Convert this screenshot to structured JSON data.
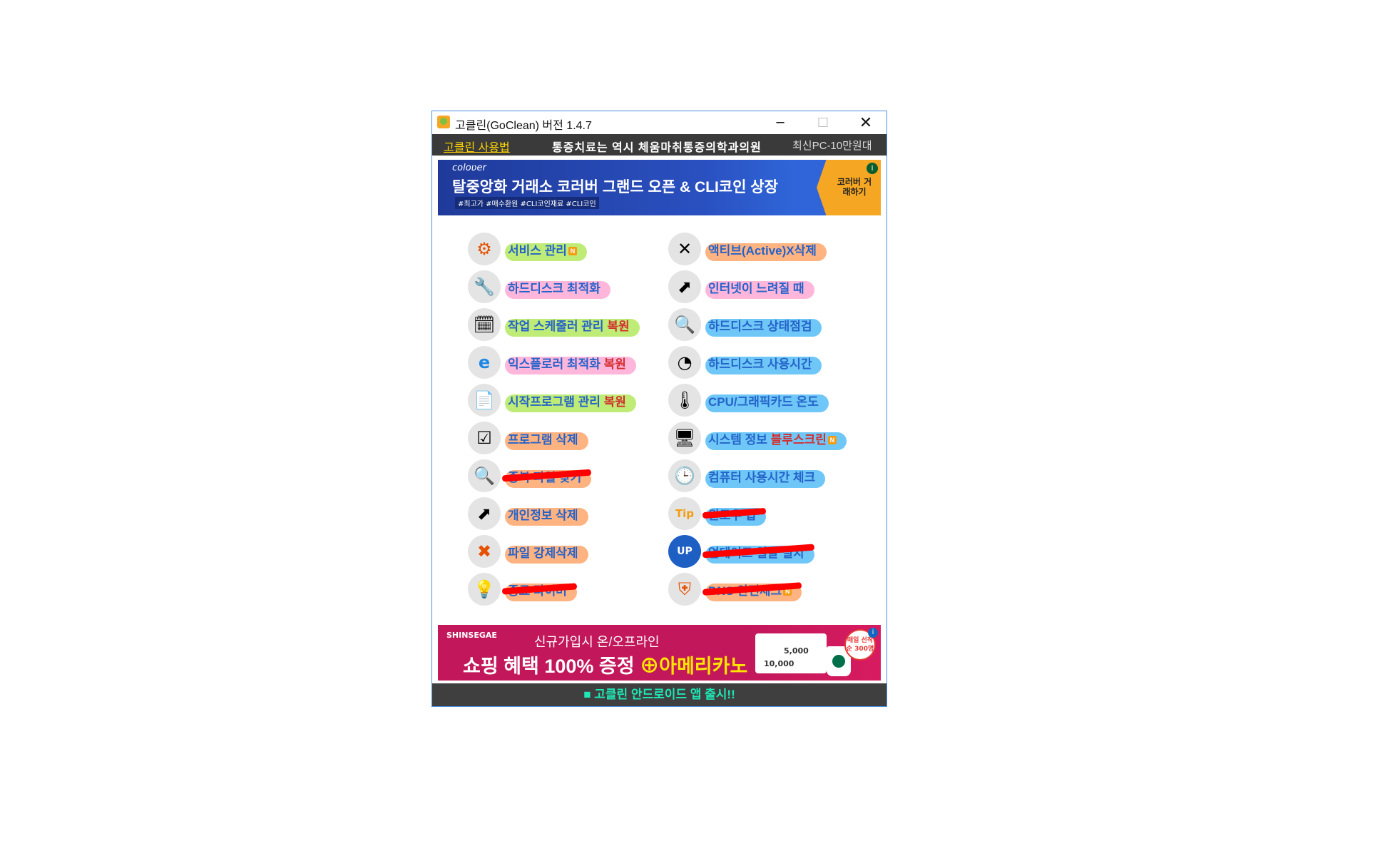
{
  "window": {
    "title": "고클린(GoClean) 버전 1.4.7",
    "min_glyph": "─",
    "max_glyph": "☐",
    "close_glyph": "✕"
  },
  "menubar": {
    "guide_link": "고클린 사용법",
    "ad_text": "통증치료는 역시 체움마취통증의학과의원",
    "ad_text2": "최신PC-10만원대"
  },
  "banner_top": {
    "brand": "coloʋer",
    "headline": "탈중앙화 거래소 코러버 그랜드 오픈 & CLI코인 상장",
    "tags": "#최고가 #매수환원 #CLI코인재료 #CLI코인",
    "cta": "코러버 거래하기",
    "info_glyph": "i"
  },
  "menu_left": [
    {
      "label": "서비스 관리",
      "badge": "N",
      "icon": "gear-icon",
      "glyph": "⚙",
      "highlight": "#9be22d",
      "struck": false
    },
    {
      "label": "하드디스크 최적화",
      "icon": "tools-icon",
      "glyph": "🔧",
      "highlight": "#ff8fc8",
      "struck": false
    },
    {
      "label": "작업 스케줄러 관리",
      "restore": "복원",
      "icon": "scheduler-icon",
      "glyph": "🗓",
      "highlight": "#9be22d",
      "struck": false
    },
    {
      "label": "익스플로러 최적화",
      "restore": "복원",
      "icon": "ie-icon",
      "glyph": "e",
      "highlight": "#ff8fc8",
      "struck": false
    },
    {
      "label": "시작프로그램 관리",
      "restore": "복원",
      "icon": "document-icon",
      "glyph": "📄",
      "highlight": "#9be22d",
      "struck": false
    },
    {
      "label": "프로그램 삭제",
      "icon": "checklist-icon",
      "glyph": "☑",
      "highlight": "#ff8a3d",
      "struck": false
    },
    {
      "label": "중복 파일 찾기",
      "icon": "magnifier-icon",
      "glyph": "🔍",
      "highlight": "#ff8a3d",
      "struck": true
    },
    {
      "label": "개인정보 삭제",
      "icon": "privacy-icon",
      "glyph": "⬈",
      "highlight": "#ff8a3d",
      "struck": false
    },
    {
      "label": "파일 강제삭제",
      "icon": "delete-x-icon",
      "glyph": "✖",
      "highlight": "#ff8a3d",
      "struck": false
    },
    {
      "label": "종료 타이머",
      "icon": "sleep-bulb-icon",
      "glyph": "💡",
      "highlight": "#ff8a3d",
      "struck": true
    }
  ],
  "menu_right": [
    {
      "label": "액티브(Active)X삭제",
      "icon": "activex-icon",
      "glyph": "✕",
      "highlight": "#ff8a3d",
      "struck": false
    },
    {
      "label": "인터넷이 느려질 때",
      "icon": "internet-arrow-icon",
      "glyph": "⬈",
      "highlight": "#ff8fc8",
      "struck": false
    },
    {
      "label": "하드디스크 상태점검",
      "icon": "disk-search-icon",
      "glyph": "🔍",
      "highlight": "#21a9f3",
      "struck": false
    },
    {
      "label": "하드디스크 사용시간",
      "icon": "disk-clock-icon",
      "glyph": "◔",
      "highlight": "#21a9f3",
      "struck": false
    },
    {
      "label": "CPU/그래픽카드 온도",
      "icon": "thermometer-icon",
      "glyph": "🌡",
      "highlight": "#21a9f3",
      "struck": false
    },
    {
      "label": "시스템 정보",
      "restore": "블루스크린",
      "badge": "N",
      "icon": "monitor-icon",
      "glyph": "🖥",
      "highlight": "#21a9f3",
      "struck": false
    },
    {
      "label": "컴퓨터 사용시간 체크",
      "icon": "clock-icon",
      "glyph": "🕒",
      "highlight": "#21a9f3",
      "struck": false
    },
    {
      "label": "윈도우 팁",
      "icon": "tip-icon",
      "glyph": "Tip",
      "highlight": "#21a9f3",
      "struck": true
    },
    {
      "label": "업데이트 일괄 설치",
      "icon": "update-icon",
      "glyph": "UP",
      "highlight": "#21a9f3",
      "struck": true
    },
    {
      "label": "DNS 안전체크",
      "badge": "N",
      "icon": "shield-icon",
      "glyph": "⛨",
      "highlight": "#ff8a3d",
      "struck": true
    }
  ],
  "banner_bottom": {
    "brand": "SHINSEGAE",
    "line1": "신규가입시 온/오프라인",
    "line2_a": "쇼핑 혜택 100% 증정",
    "line2_b": "⊕아메리카노",
    "coupon_a": "5,000",
    "coupon_b": "10,000",
    "stamp": "매일 선착순 300명",
    "info_glyph": "i"
  },
  "footer": {
    "text": "■ 고클린 안드로이드 앱 출시!!"
  }
}
